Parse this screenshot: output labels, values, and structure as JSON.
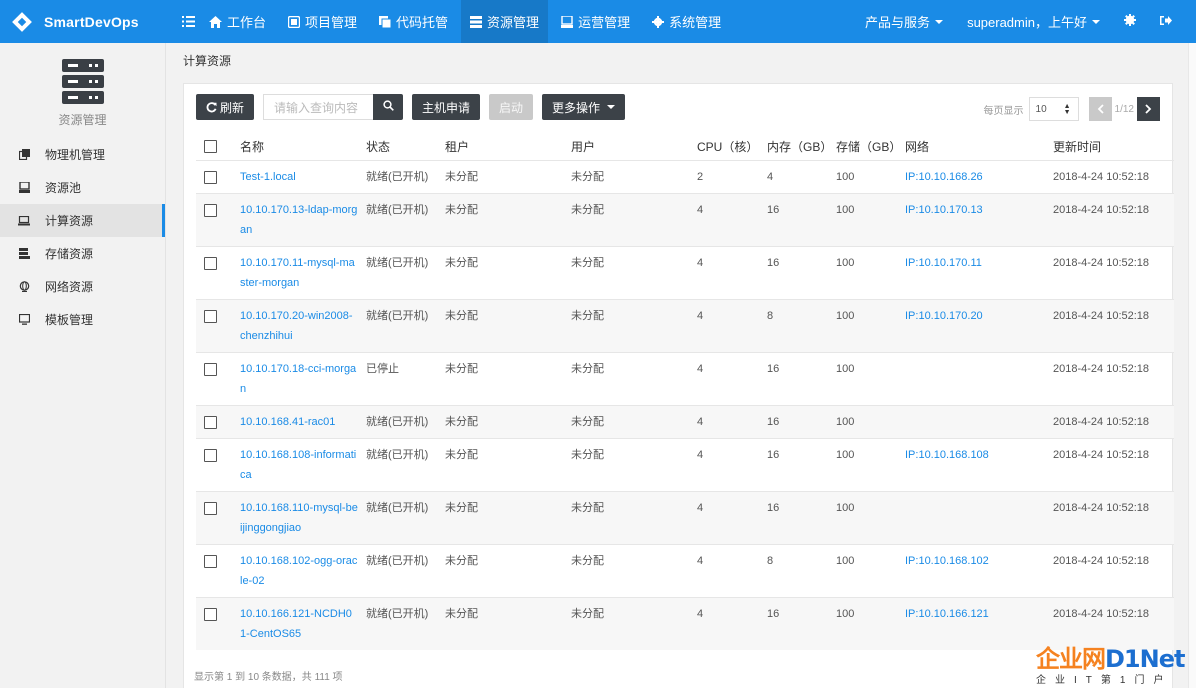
{
  "brand": {
    "name": "SmartDevOps"
  },
  "nav": {
    "items": [
      {
        "label": "工作台",
        "icon": "home-icon",
        "active": false
      },
      {
        "label": "项目管理",
        "icon": "project-icon",
        "active": false
      },
      {
        "label": "代码托管",
        "icon": "code-icon",
        "active": false
      },
      {
        "label": "资源管理",
        "icon": "resource-icon",
        "active": true
      },
      {
        "label": "运营管理",
        "icon": "operation-icon",
        "active": false
      },
      {
        "label": "系统管理",
        "icon": "gear-icon",
        "active": false
      }
    ],
    "products": "产品与服务",
    "user": "superadmin，上午好"
  },
  "sidebar": {
    "title": "资源管理",
    "items": [
      {
        "label": "物理机管理",
        "icon": "copy-icon",
        "active": false
      },
      {
        "label": "资源池",
        "icon": "database-icon",
        "active": false
      },
      {
        "label": "计算资源",
        "icon": "laptop-icon",
        "active": true
      },
      {
        "label": "存储资源",
        "icon": "storage-icon",
        "active": false
      },
      {
        "label": "网络资源",
        "icon": "globe-icon",
        "active": false
      },
      {
        "label": "模板管理",
        "icon": "monitor-icon",
        "active": false
      }
    ]
  },
  "page": {
    "title": "计算资源"
  },
  "toolbar": {
    "refresh": "刷新",
    "search_placeholder": "请输入查询内容",
    "apply": "主机申请",
    "start": "启动",
    "more": "更多操作"
  },
  "pager": {
    "per_page_label": "每页显示",
    "page_size": "10",
    "info": "1/12"
  },
  "table": {
    "headers": [
      "名称",
      "状态",
      "租户",
      "用户",
      "CPU（核）",
      "内存（GB）",
      "存储（GB）",
      "网络",
      "更新时间"
    ],
    "rows": [
      {
        "name": "Test-1.local",
        "status": "就绪(已开机)",
        "tenant": "未分配",
        "user": "未分配",
        "cpu": "2",
        "mem": "4",
        "storage": "100",
        "network": "IP:10.10.168.26",
        "updated": "2018-4-24 10:52:18"
      },
      {
        "name": "10.10.170.13-ldap-morgan",
        "status": "就绪(已开机)",
        "tenant": "未分配",
        "user": "未分配",
        "cpu": "4",
        "mem": "16",
        "storage": "100",
        "network": "IP:10.10.170.13",
        "updated": "2018-4-24 10:52:18"
      },
      {
        "name": "10.10.170.11-mysql-master-morgan",
        "status": "就绪(已开机)",
        "tenant": "未分配",
        "user": "未分配",
        "cpu": "4",
        "mem": "16",
        "storage": "100",
        "network": "IP:10.10.170.11",
        "updated": "2018-4-24 10:52:18"
      },
      {
        "name": "10.10.170.20-win2008-chenzhihui",
        "status": "就绪(已开机)",
        "tenant": "未分配",
        "user": "未分配",
        "cpu": "4",
        "mem": "8",
        "storage": "100",
        "network": "IP:10.10.170.20",
        "updated": "2018-4-24 10:52:18"
      },
      {
        "name": "10.10.170.18-cci-morgan",
        "status": "已停止",
        "tenant": "未分配",
        "user": "未分配",
        "cpu": "4",
        "mem": "16",
        "storage": "100",
        "network": "",
        "updated": "2018-4-24 10:52:18"
      },
      {
        "name": "10.10.168.41-rac01",
        "status": "就绪(已开机)",
        "tenant": "未分配",
        "user": "未分配",
        "cpu": "4",
        "mem": "16",
        "storage": "100",
        "network": "",
        "updated": "2018-4-24 10:52:18"
      },
      {
        "name": "10.10.168.108-informatica",
        "status": "就绪(已开机)",
        "tenant": "未分配",
        "user": "未分配",
        "cpu": "4",
        "mem": "16",
        "storage": "100",
        "network": "IP:10.10.168.108",
        "updated": "2018-4-24 10:52:18"
      },
      {
        "name": "10.10.168.110-mysql-beijinggongjiao",
        "status": "就绪(已开机)",
        "tenant": "未分配",
        "user": "未分配",
        "cpu": "4",
        "mem": "16",
        "storage": "100",
        "network": "",
        "updated": "2018-4-24 10:52:18"
      },
      {
        "name": "10.10.168.102-ogg-oracle-02",
        "status": "就绪(已开机)",
        "tenant": "未分配",
        "user": "未分配",
        "cpu": "4",
        "mem": "8",
        "storage": "100",
        "network": "IP:10.10.168.102",
        "updated": "2018-4-24 10:52:18"
      },
      {
        "name": "10.10.166.121-NCDH01-CentOS65",
        "status": "就绪(已开机)",
        "tenant": "未分配",
        "user": "未分配",
        "cpu": "4",
        "mem": "16",
        "storage": "100",
        "network": "IP:10.10.166.121",
        "updated": "2018-4-24 10:52:18"
      }
    ]
  },
  "footer": {
    "info": "显示第 1 到 10 条数据，共 111 项"
  },
  "watermark": {
    "text_a": "企业网",
    "text_b": "D1Net",
    "sub": "企业IT第1门户"
  },
  "colors": {
    "primary": "#1a8be6",
    "dark_button": "#3c4248",
    "link": "#1a8be6"
  }
}
